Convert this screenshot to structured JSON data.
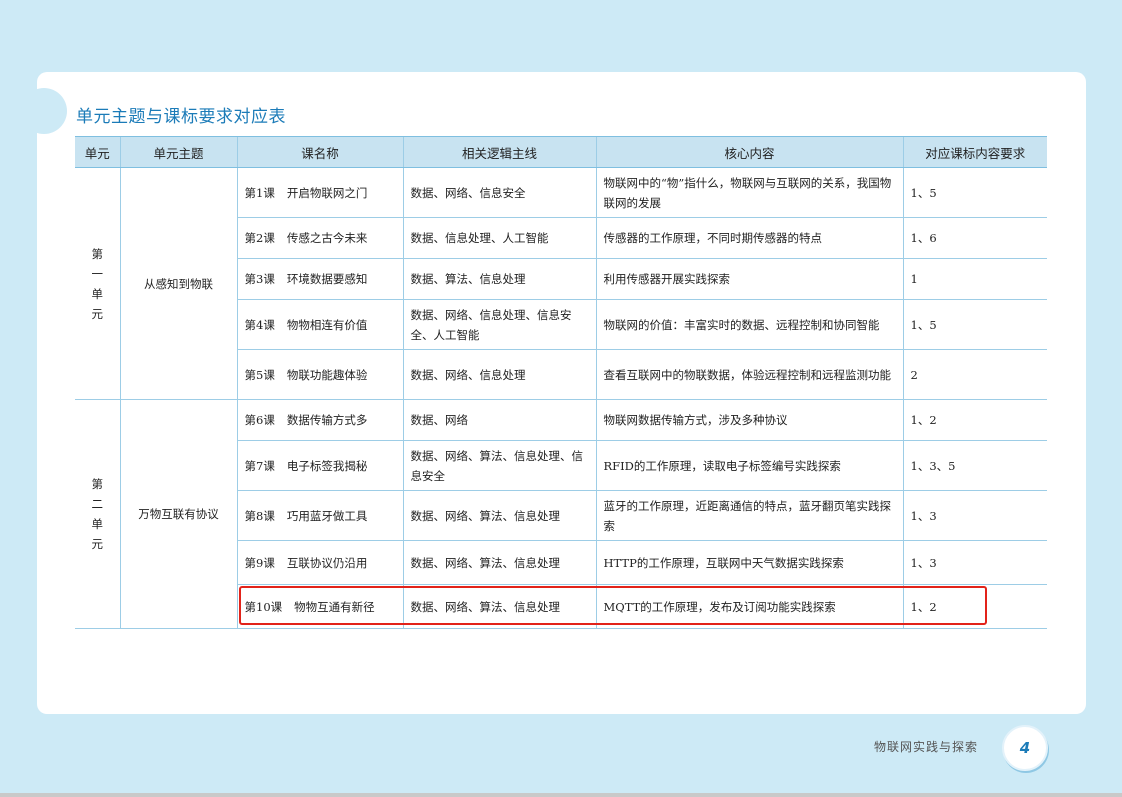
{
  "page": {
    "title": "单元主题与课标要求对应表",
    "footer": "物联网实践与探索",
    "page_number": "4"
  },
  "table": {
    "headers": [
      "单元",
      "单元主题",
      "课名称",
      "相关逻辑主线",
      "核心内容",
      "对应课标内容要求"
    ],
    "units": [
      {
        "unit_chars": [
          "第",
          "一",
          "单",
          "元"
        ],
        "theme": "从感知到物联",
        "rows": [
          {
            "num": "第1课",
            "title": "开启物联网之门",
            "logic": "数据、网络、信息安全",
            "core": "物联网中的“物”指什么，物联网与互联网的关系，我国物联网的发展",
            "req": "1、5"
          },
          {
            "num": "第2课",
            "title": "传感之古今未来",
            "logic": "数据、信息处理、人工智能",
            "core": "传感器的工作原理，不同时期传感器的特点",
            "req": "1、6"
          },
          {
            "num": "第3课",
            "title": "环境数据要感知",
            "logic": "数据、算法、信息处理",
            "core": "利用传感器开展实践探索",
            "req": "1"
          },
          {
            "num": "第4课",
            "title": "物物相连有价值",
            "logic": "数据、网络、信息处理、信息安全、人工智能",
            "core": "物联网的价值：丰富实时的数据、远程控制和协同智能",
            "req": "1、5"
          },
          {
            "num": "第5课",
            "title": "物联功能趣体验",
            "logic": "数据、网络、信息处理",
            "core": "查看互联网中的物联数据，体验远程控制和远程监测功能",
            "req": "2"
          }
        ]
      },
      {
        "unit_chars": [
          "第",
          "二",
          "单",
          "元"
        ],
        "theme": "万物互联有协议",
        "rows": [
          {
            "num": "第6课",
            "title": "数据传输方式多",
            "logic": "数据、网络",
            "core": "物联网数据传输方式，涉及多种协议",
            "req": "1、2"
          },
          {
            "num": "第7课",
            "title": "电子标签我揭秘",
            "logic": "数据、网络、算法、信息处理、信息安全",
            "core": "RFID的工作原理，读取电子标签编号实践探索",
            "req": "1、3、5"
          },
          {
            "num": "第8课",
            "title": "巧用蓝牙做工具",
            "logic": "数据、网络、算法、信息处理",
            "core": "蓝牙的工作原理，近距离通信的特点，蓝牙翻页笔实践探索",
            "req": "1、3"
          },
          {
            "num": "第9课",
            "title": "互联协议仍沿用",
            "logic": "数据、网络、算法、信息处理",
            "core": "HTTP的工作原理，互联网中天气数据实践探索",
            "req": "1、3"
          },
          {
            "num": "第10课",
            "title": "物物互通有新径",
            "logic": "数据、网络、算法、信息处理",
            "core": "MQTT的工作原理，发布及订阅功能实践探索",
            "req": "1、2"
          }
        ]
      }
    ]
  },
  "colors": {
    "background": "#cdeaf6",
    "title": "#1b7bb8",
    "header_fill": "#c8e3f1",
    "highlight": "#e2231a"
  }
}
